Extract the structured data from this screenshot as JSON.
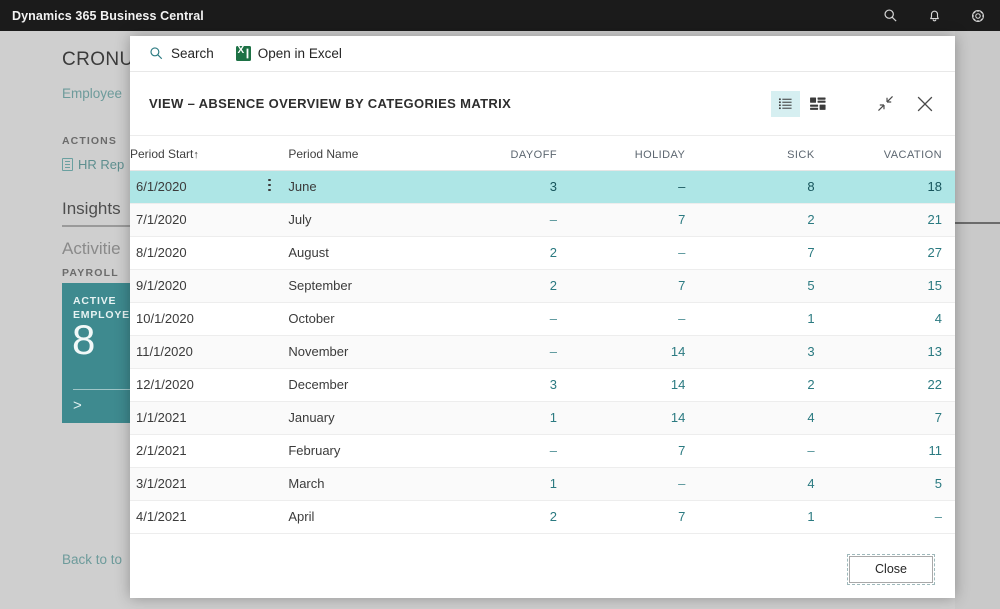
{
  "appbar": {
    "title": "Dynamics 365 Business Central",
    "icons": [
      {
        "name": "search-icon",
        "label": "Search"
      },
      {
        "name": "notifications-bell-icon",
        "label": "Notifications"
      },
      {
        "name": "settings-gear-icon",
        "label": "Settings"
      }
    ]
  },
  "background_page": {
    "company": "CRONU",
    "employees_link": "Employee",
    "actions_label": "ACTIONS",
    "hr_reports": "HR Rep",
    "insights": "Insights",
    "activities": "Activitie",
    "payroll_label": "PAYROLL",
    "tile": {
      "label": "ACTIVE\nEMPLOYE",
      "value": "8",
      "chevron": ">"
    },
    "back_to_top": "Back to to"
  },
  "dialog": {
    "toolbar": {
      "search_label": "Search",
      "open_in_excel_label": "Open in Excel"
    },
    "title": "VIEW – ABSENCE OVERVIEW BY CATEGORIES MATRIX",
    "view_toggles": [
      {
        "name": "list-view-icon",
        "label": "List view",
        "selected": true
      },
      {
        "name": "tile-view-icon",
        "label": "Tile view",
        "selected": false
      }
    ],
    "window_actions": [
      {
        "name": "restore-down-icon",
        "label": "Restore down"
      },
      {
        "name": "close-icon",
        "label": "Close"
      }
    ],
    "footer": {
      "close_label": "Close"
    }
  },
  "table": {
    "columns": [
      {
        "key": "period_start",
        "label": "Period Start",
        "sorted": "asc",
        "sort_glyph": "↑",
        "align": "left"
      },
      {
        "key": "period_name",
        "label": "Period Name",
        "align": "left"
      },
      {
        "key": "dayoff",
        "label": "DAYOFF",
        "align": "right"
      },
      {
        "key": "holiday",
        "label": "HOLIDAY",
        "align": "right"
      },
      {
        "key": "sick",
        "label": "SICK",
        "align": "right"
      },
      {
        "key": "vacation",
        "label": "VACATION",
        "align": "right"
      }
    ],
    "empty_value_glyph": "–",
    "selected_row_index": 0,
    "rows": [
      {
        "period_start": "6/1/2020",
        "period_name": "June",
        "dayoff": "3",
        "holiday": "–",
        "sick": "8",
        "vacation": "18"
      },
      {
        "period_start": "7/1/2020",
        "period_name": "July",
        "dayoff": "–",
        "holiday": "7",
        "sick": "2",
        "vacation": "21"
      },
      {
        "period_start": "8/1/2020",
        "period_name": "August",
        "dayoff": "2",
        "holiday": "–",
        "sick": "7",
        "vacation": "27"
      },
      {
        "period_start": "9/1/2020",
        "period_name": "September",
        "dayoff": "2",
        "holiday": "7",
        "sick": "5",
        "vacation": "15"
      },
      {
        "period_start": "10/1/2020",
        "period_name": "October",
        "dayoff": "–",
        "holiday": "–",
        "sick": "1",
        "vacation": "4"
      },
      {
        "period_start": "11/1/2020",
        "period_name": "November",
        "dayoff": "–",
        "holiday": "14",
        "sick": "3",
        "vacation": "13"
      },
      {
        "period_start": "12/1/2020",
        "period_name": "December",
        "dayoff": "3",
        "holiday": "14",
        "sick": "2",
        "vacation": "22"
      },
      {
        "period_start": "1/1/2021",
        "period_name": "January",
        "dayoff": "1",
        "holiday": "14",
        "sick": "4",
        "vacation": "7"
      },
      {
        "period_start": "2/1/2021",
        "period_name": "February",
        "dayoff": "–",
        "holiday": "7",
        "sick": "–",
        "vacation": "11"
      },
      {
        "period_start": "3/1/2021",
        "period_name": "March",
        "dayoff": "1",
        "holiday": "–",
        "sick": "4",
        "vacation": "5"
      },
      {
        "period_start": "4/1/2021",
        "period_name": "April",
        "dayoff": "2",
        "holiday": "7",
        "sick": "1",
        "vacation": "–"
      }
    ]
  },
  "colors": {
    "appbar_bg": "#1b1b1b",
    "accent_teal": "#2b7a81",
    "selected_row": "#aee6e6",
    "tile_teal": "#3e8a8f",
    "excel_green": "#1d7145",
    "toggle_selected_bg": "#d6eff1"
  }
}
